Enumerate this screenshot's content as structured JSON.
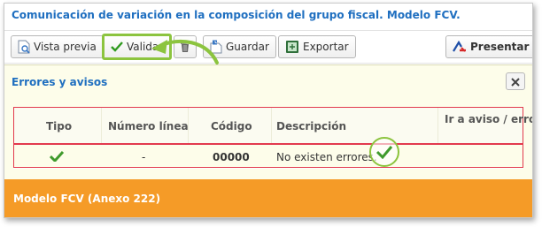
{
  "window": {
    "title": "Comunicación de variación en la composición del grupo fiscal. Modelo FCV."
  },
  "toolbar": {
    "vista_previa": "Vista previa",
    "validar": "Validar",
    "guardar": "Guardar",
    "exportar": "Exportar",
    "presentar": "Presentar"
  },
  "panel": {
    "title": "Errores y avisos",
    "columns": [
      "Tipo",
      "Número línea",
      "Código",
      "Descripción",
      "Ir a aviso / erro"
    ],
    "rows": [
      {
        "tipo_icon": "check-icon",
        "numero_linea": "-",
        "codigo": "00000",
        "descripcion": "No existen errores."
      }
    ]
  },
  "footer": {
    "title": "Modelo FCV (Anexo 222)"
  },
  "colors": {
    "title_blue": "#1f6fc0",
    "highlight_green": "#8cc43f",
    "highlight_red": "#e23a4e",
    "panel_bg": "#fdfdea",
    "footer_orange": "#f59b27"
  }
}
